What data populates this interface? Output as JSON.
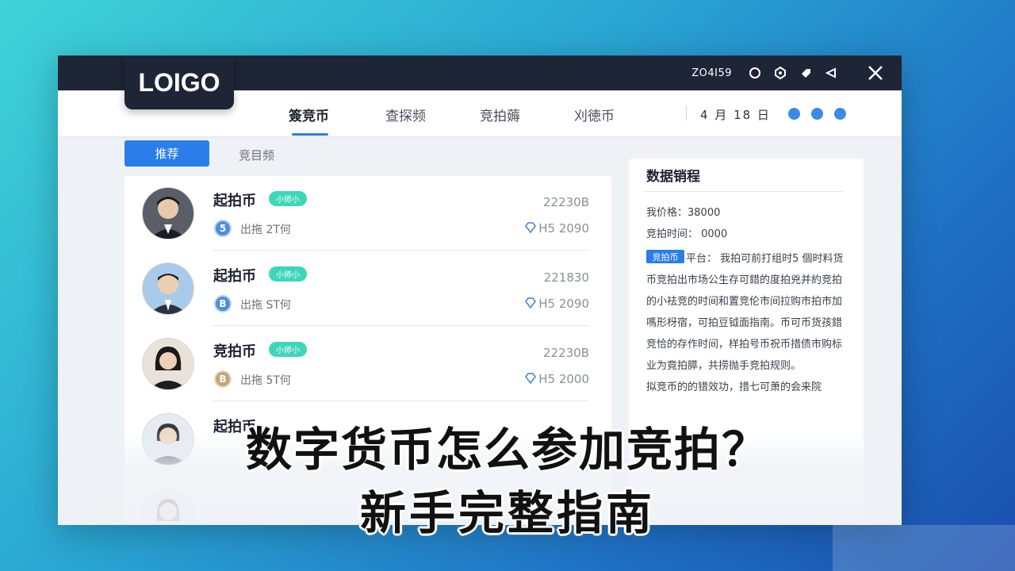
{
  "window": {
    "logo": "LOIGO",
    "titlebar_code": "ZO4I59",
    "nav": {
      "tabs": [
        {
          "label": "簽竞币",
          "active": true
        },
        {
          "label": "查探频",
          "active": false
        },
        {
          "label": "竞拍薅",
          "active": false
        },
        {
          "label": "刈徳币",
          "active": false
        }
      ],
      "date": "4 月  18 日"
    },
    "subtabs": {
      "active": "推荐",
      "other": "竞目频"
    },
    "list": [
      {
        "name": "起拍币",
        "tag": "小师小",
        "coin": "5",
        "meta": "出拖  2T何",
        "code": "22230B",
        "price": "H5 2090"
      },
      {
        "name": "起拍币",
        "tag": "小师小",
        "coin": "B",
        "meta": "出拖  ST何",
        "code": "221830",
        "price": "H5 2090"
      },
      {
        "name": "竞拍币",
        "tag": "小师小",
        "coin": "B",
        "meta": "出拖  5T何",
        "code": "22230B",
        "price": "H5 2000"
      },
      {
        "name": "起拍币",
        "tag": "",
        "coin": "",
        "meta": "",
        "code": "",
        "price": ""
      }
    ],
    "side": {
      "title": "数据销程",
      "price_row": "我价格：38000",
      "time_row": "竞拍时间：  0000",
      "tag": "竞拍币",
      "paragraph": "平台：  我拍可前打组时5 個时料货币竞拍出市场公生存可錯的度拍兇并約竞拍的小袪竞的时间和置竞伦市间拉购市拍市加嗎形枒宿，可拍豆钺面指南。币可币货孩錯竞恰的存作时间，样拍号币祝币措债市购标业为竟拍膵，共捞抛手竞拍规则。",
      "paragraph2": "拟竞币的的错效功，措七可萧的会来院"
    }
  },
  "caption": {
    "line1": "数字货币怎么参加竞拍？",
    "line2": "新手完整指南"
  },
  "colors": {
    "accent": "#2b7de9",
    "tag": "#3fd6b8",
    "titlebar": "#1e2536"
  }
}
